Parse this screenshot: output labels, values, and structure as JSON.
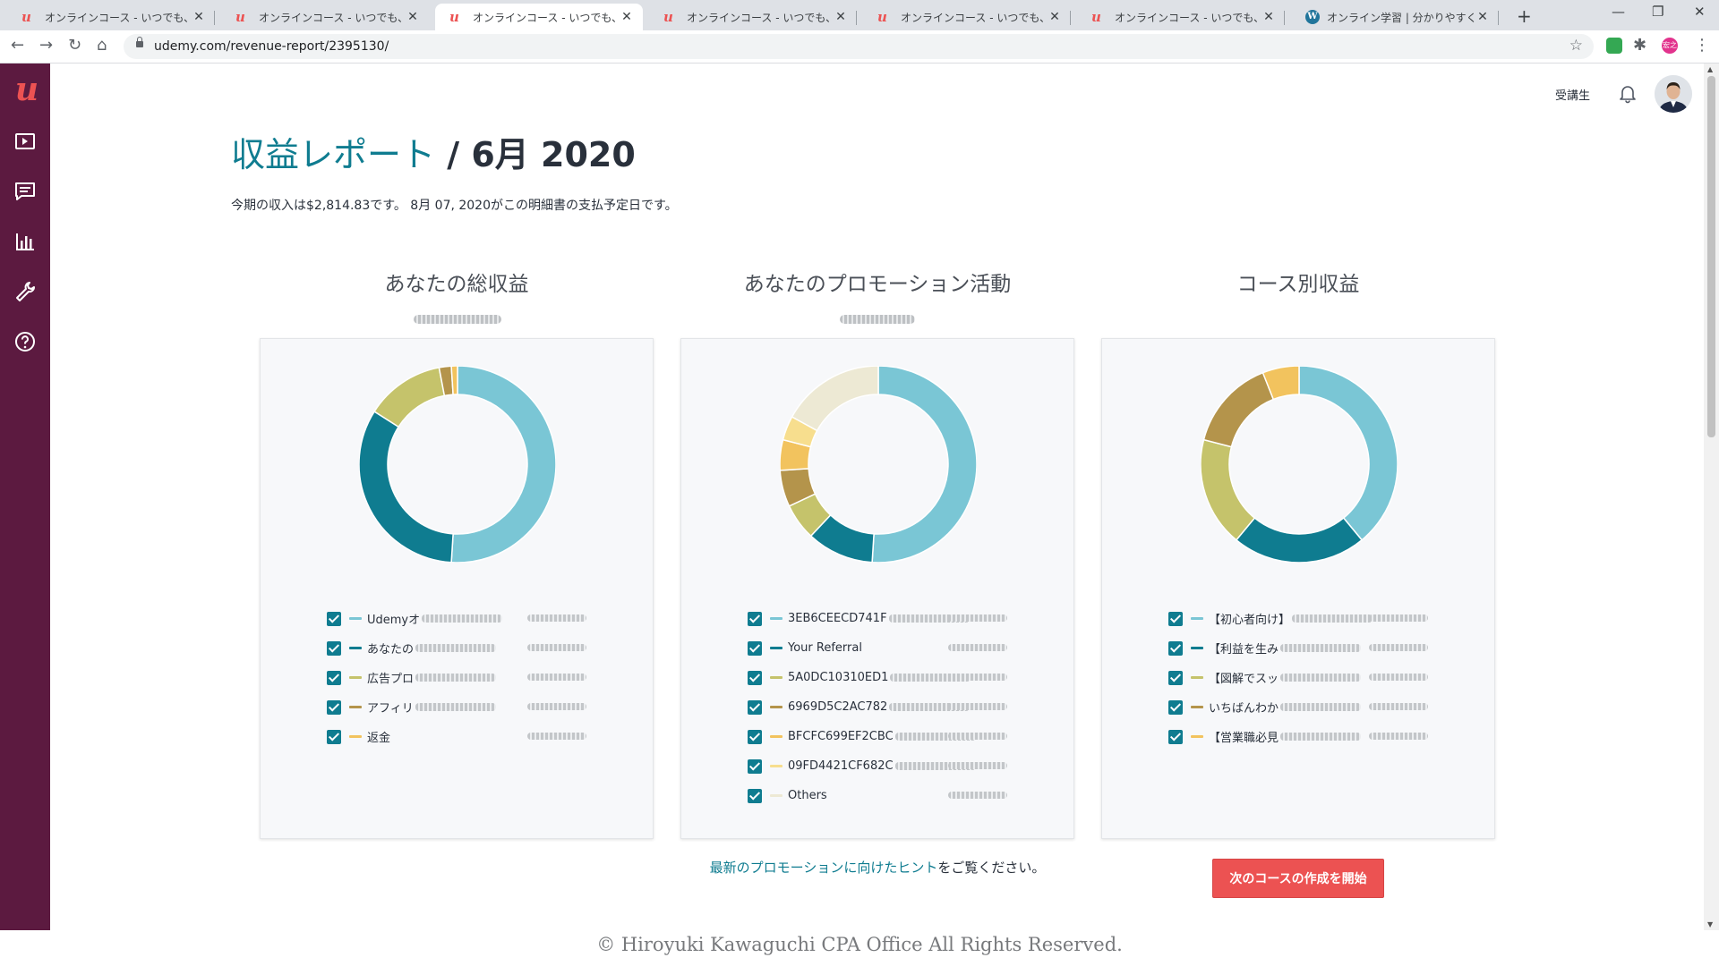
{
  "browser": {
    "tabs": [
      {
        "title": "オンラインコース - いつでも、どこでも |",
        "favicon": "udemy"
      },
      {
        "title": "オンラインコース - いつでも、どこでも |",
        "favicon": "udemy"
      },
      {
        "title": "オンラインコース - いつでも、どこでも |",
        "favicon": "udemy",
        "active": true
      },
      {
        "title": "オンラインコース - いつでも、どこでも |",
        "favicon": "udemy"
      },
      {
        "title": "オンラインコース - いつでも、どこでも |",
        "favicon": "udemy"
      },
      {
        "title": "オンラインコース - いつでも、どこでも |",
        "favicon": "udemy"
      },
      {
        "title": "オンライン学習 | 分かりやすく会計を",
        "favicon": "wordpress"
      }
    ],
    "url": "udemy.com/revenue-report/2395130/",
    "profile_initials": "宏之"
  },
  "sidebar": {
    "logo": "u",
    "icons": [
      "courses-icon",
      "messages-icon",
      "performance-icon",
      "tools-icon",
      "help-icon"
    ]
  },
  "header": {
    "student_link": "受講生"
  },
  "page": {
    "title_crumb": "収益レポート",
    "title_separator": " / ",
    "title_period": "6月 2020",
    "summary": "今期の収入は$2,814.83です。 8月 07, 2020がこの明細書の支払予定日です。"
  },
  "sections": [
    {
      "title": "あなたの総収益",
      "chart_data": {
        "type": "pie",
        "slices": [
          {
            "label": "Udemyオ",
            "value": 51,
            "color": "#7ac6d5"
          },
          {
            "label": "あなたの",
            "value": 33,
            "color": "#0f7c90"
          },
          {
            "label": "広告プロ",
            "value": 13,
            "color": "#c5c36b"
          },
          {
            "label": "アフィリ",
            "value": 2,
            "color": "#b4944b"
          },
          {
            "label": "返金",
            "value": 1,
            "color": "#f2c35e"
          }
        ]
      }
    },
    {
      "title": "あなたのプロモーション活動",
      "chart_data": {
        "type": "pie",
        "slices": [
          {
            "label": "3EB6CEECD741F",
            "value": 51,
            "color": "#7ac6d5"
          },
          {
            "label": "Your Referral",
            "value": 11,
            "color": "#0f7c90"
          },
          {
            "label": "5A0DC10310ED1",
            "value": 6,
            "color": "#c5c36b"
          },
          {
            "label": "6969D5C2AC782",
            "value": 6,
            "color": "#b4944b"
          },
          {
            "label": "BFCFC699EF2CBC",
            "value": 5,
            "color": "#f2c35e"
          },
          {
            "label": "09FD4421CF682C",
            "value": 4,
            "color": "#f7de8e"
          },
          {
            "label": "Others",
            "value": 17,
            "color": "#ede9d4"
          }
        ]
      }
    },
    {
      "title": "コース別収益",
      "chart_data": {
        "type": "pie",
        "slices": [
          {
            "label": "【初心者向け】",
            "value": 39,
            "color": "#7ac6d5"
          },
          {
            "label": "【利益を生み",
            "value": 22,
            "color": "#0f7c90"
          },
          {
            "label": "【図解でスッ",
            "value": 18,
            "color": "#c5c36b"
          },
          {
            "label": "いちばんわか",
            "value": 15,
            "color": "#b4944b"
          },
          {
            "label": "【営業職必見",
            "value": 6,
            "color": "#f2c35e"
          }
        ]
      }
    }
  ],
  "promo_hint": {
    "link": "最新のプロモーションに向けたヒント",
    "suffix": "をご覧ください。"
  },
  "cta_button": "次のコースの作成を開始",
  "footer": {
    "copyright": "© Hiroyuki Kawaguchi CPA Office All Rights Reserved."
  }
}
